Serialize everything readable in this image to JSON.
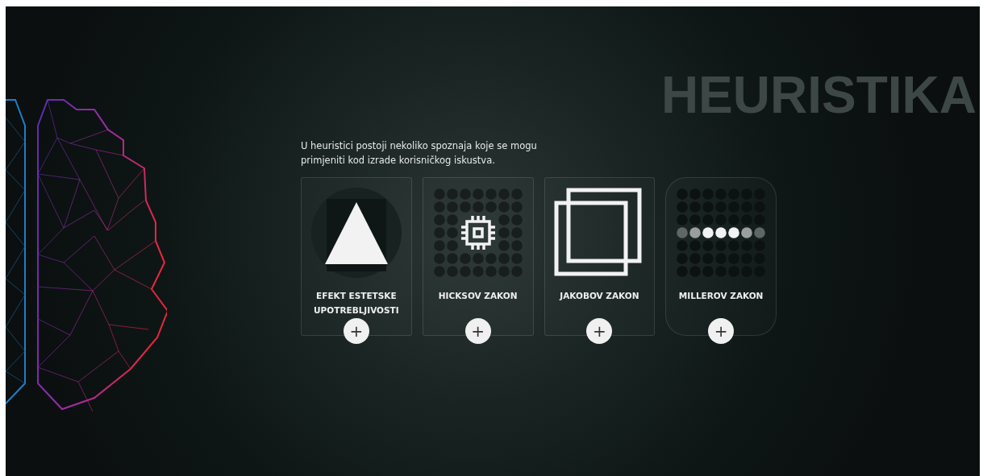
{
  "heading": "HEURISTIKA",
  "intro": "U heuristici postoji nekoliko spoznaja koje se mogu primjeniti kod izrade korisničkog iskustva.",
  "cards": [
    {
      "kind": "triangle",
      "title": "EFEKT ESTETSKE UPOTREBLJIVOSTI",
      "button": "+"
    },
    {
      "kind": "chip",
      "title": "HICKSOV ZAKON",
      "button": "+"
    },
    {
      "kind": "squares",
      "title": "JAKOBOV ZAKON",
      "button": "+"
    },
    {
      "kind": "dots",
      "title": "MILLEROV ZAKON",
      "button": "+"
    }
  ]
}
